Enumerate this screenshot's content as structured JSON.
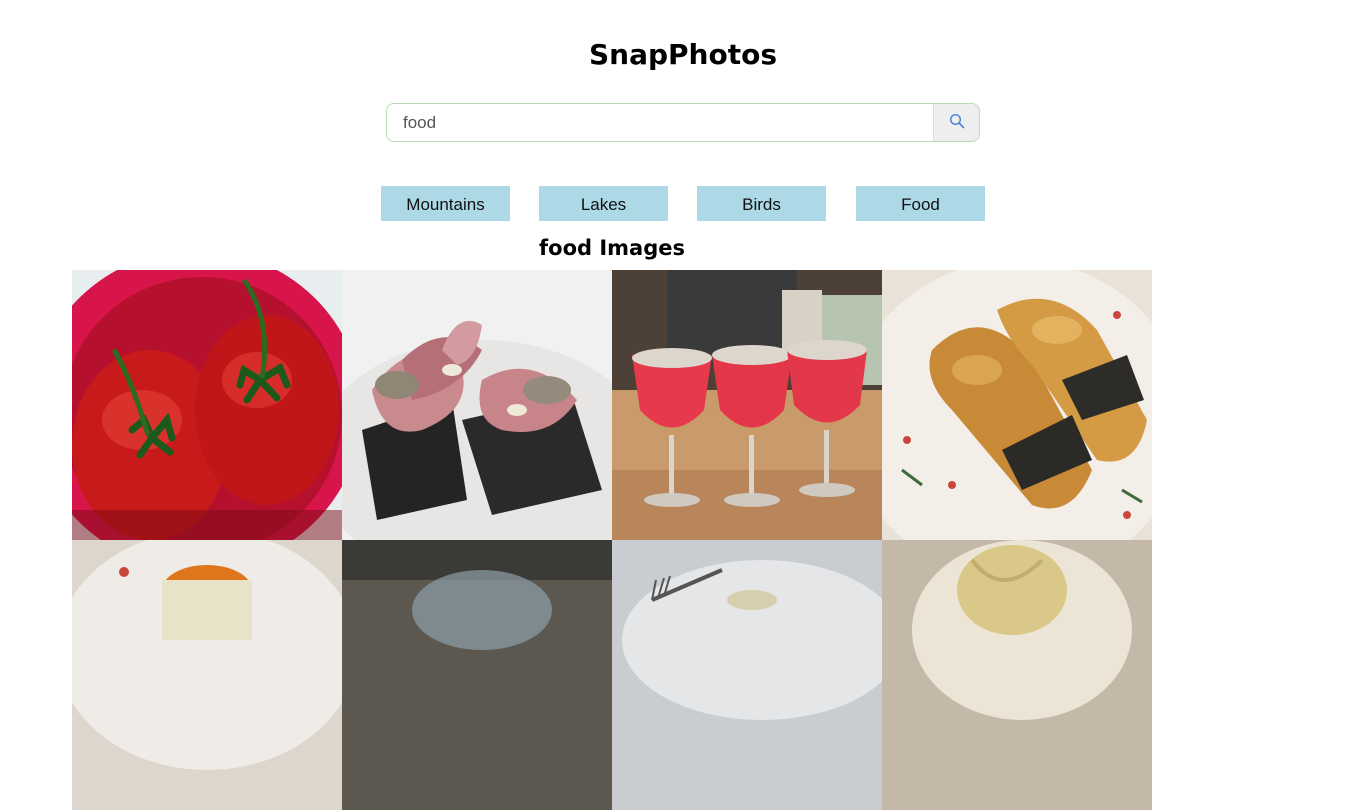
{
  "header": {
    "title": "SnapPhotos"
  },
  "search": {
    "value": "food",
    "button_icon": "search-icon"
  },
  "categories": [
    {
      "label": "Mountains"
    },
    {
      "label": "Lakes"
    },
    {
      "label": "Birds"
    },
    {
      "label": "Food"
    }
  ],
  "results": {
    "title": "food Images",
    "images": [
      {
        "subject": "tomatoes"
      },
      {
        "subject": "cured meat on seaweed toast"
      },
      {
        "subject": "red drinks in glasses"
      },
      {
        "subject": "seaweed wrapped rolls"
      },
      {
        "subject": "roe topped dish"
      },
      {
        "subject": "plated dish"
      },
      {
        "subject": "plate with fork"
      },
      {
        "subject": "noodle bowl"
      }
    ]
  },
  "colors": {
    "category_button": "#add8e6",
    "search_border": "#b9dcb4",
    "search_button": "#eeeeee"
  }
}
